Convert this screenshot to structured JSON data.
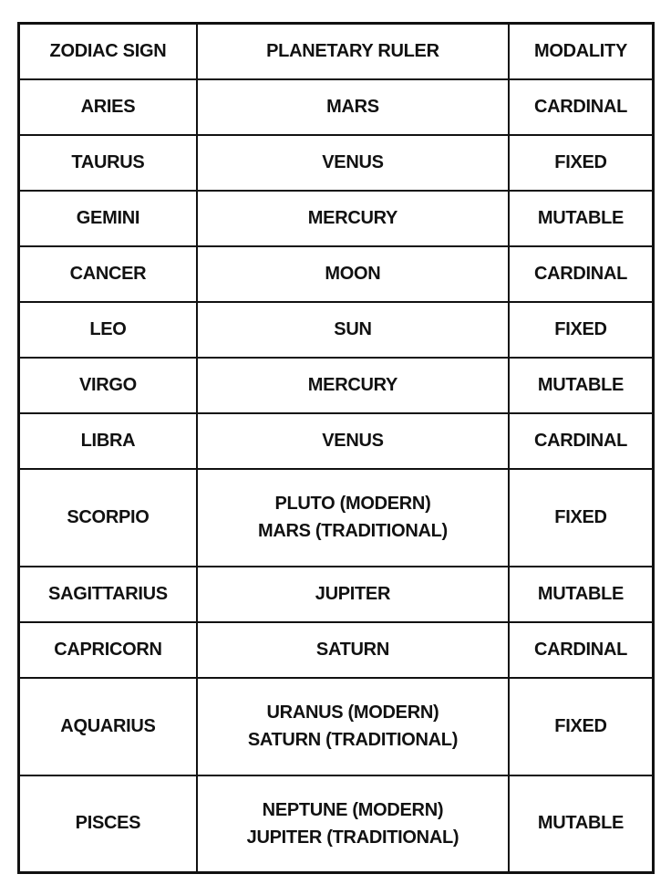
{
  "headers": {
    "sign": "ZODIAC SIGN",
    "ruler": "PLANETARY RULER",
    "modality": "MODALITY"
  },
  "rows": [
    {
      "sign": "ARIES",
      "ruler": [
        "MARS"
      ],
      "modality": "CARDINAL"
    },
    {
      "sign": "TAURUS",
      "ruler": [
        "VENUS"
      ],
      "modality": "FIXED"
    },
    {
      "sign": "GEMINI",
      "ruler": [
        "MERCURY"
      ],
      "modality": "MUTABLE"
    },
    {
      "sign": "CANCER",
      "ruler": [
        "MOON"
      ],
      "modality": "CARDINAL"
    },
    {
      "sign": "LEO",
      "ruler": [
        "SUN"
      ],
      "modality": "FIXED"
    },
    {
      "sign": "VIRGO",
      "ruler": [
        "MERCURY"
      ],
      "modality": "MUTABLE"
    },
    {
      "sign": "LIBRA",
      "ruler": [
        "VENUS"
      ],
      "modality": "CARDINAL"
    },
    {
      "sign": "SCORPIO",
      "ruler": [
        "PLUTO (MODERN)",
        "MARS (TRADITIONAL)"
      ],
      "modality": "FIXED"
    },
    {
      "sign": "SAGITTARIUS",
      "ruler": [
        "JUPITER"
      ],
      "modality": "MUTABLE"
    },
    {
      "sign": "CAPRICORN",
      "ruler": [
        "SATURN"
      ],
      "modality": "CARDINAL"
    },
    {
      "sign": "AQUARIUS",
      "ruler": [
        "URANUS (MODERN)",
        "SATURN (TRADITIONAL)"
      ],
      "modality": "FIXED"
    },
    {
      "sign": "PISCES",
      "ruler": [
        "NEPTUNE (MODERN)",
        "JUPITER (TRADITIONAL)"
      ],
      "modality": "MUTABLE"
    }
  ]
}
